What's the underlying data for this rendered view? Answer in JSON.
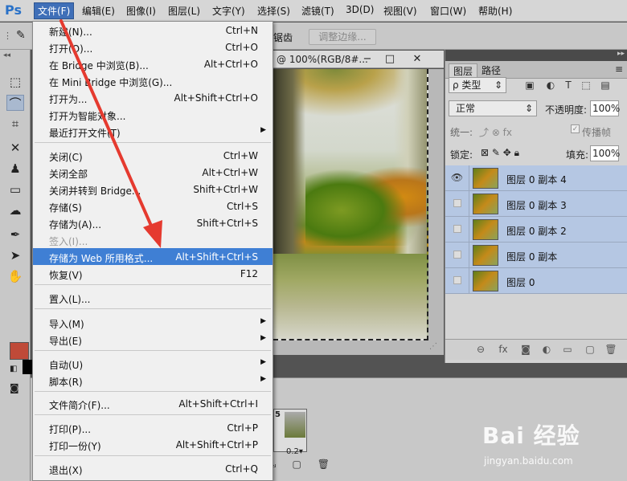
{
  "app": {
    "logo": "Ps"
  },
  "menubar": {
    "items": [
      {
        "label": "文件(F)"
      },
      {
        "label": "编辑(E)"
      },
      {
        "label": "图像(I)"
      },
      {
        "label": "图层(L)"
      },
      {
        "label": "文字(Y)"
      },
      {
        "label": "选择(S)"
      },
      {
        "label": "滤镜(T)"
      },
      {
        "label": "3D(D)"
      },
      {
        "label": "视图(V)"
      },
      {
        "label": "窗口(W)"
      },
      {
        "label": "帮助(H)"
      }
    ]
  },
  "options": {
    "partial_label": "锯齿",
    "refine_edge": "调整边缘..."
  },
  "document": {
    "title": "@ 100%(RGB/8#...",
    "minimize": "−",
    "maximize": "□",
    "close": "✕"
  },
  "file_menu": {
    "items": [
      {
        "label": "新建(N)...",
        "shortcut": "Ctrl+N"
      },
      {
        "label": "打开(O)...",
        "shortcut": "Ctrl+O"
      },
      {
        "label": "在 Bridge 中浏览(B)...",
        "shortcut": "Alt+Ctrl+O"
      },
      {
        "label": "在 Mini Bridge 中浏览(G)...",
        "shortcut": ""
      },
      {
        "label": "打开为...",
        "shortcut": "Alt+Shift+Ctrl+O"
      },
      {
        "label": "打开为智能对象...",
        "shortcut": ""
      },
      {
        "label": "最近打开文件(T)",
        "shortcut": ""
      },
      {
        "label": "关闭(C)",
        "shortcut": "Ctrl+W"
      },
      {
        "label": "关闭全部",
        "shortcut": "Alt+Ctrl+W"
      },
      {
        "label": "关闭并转到 Bridge...",
        "shortcut": "Shift+Ctrl+W"
      },
      {
        "label": "存储(S)",
        "shortcut": "Ctrl+S"
      },
      {
        "label": "存储为(A)...",
        "shortcut": "Shift+Ctrl+S"
      },
      {
        "label": "签入(I)...",
        "shortcut": ""
      },
      {
        "label": "存储为 Web 所用格式...",
        "shortcut": "Alt+Shift+Ctrl+S"
      },
      {
        "label": "恢复(V)",
        "shortcut": "F12"
      },
      {
        "label": "置入(L)...",
        "shortcut": ""
      },
      {
        "label": "导入(M)",
        "shortcut": ""
      },
      {
        "label": "导出(E)",
        "shortcut": ""
      },
      {
        "label": "自动(U)",
        "shortcut": ""
      },
      {
        "label": "脚本(R)",
        "shortcut": ""
      },
      {
        "label": "文件简介(F)...",
        "shortcut": "Alt+Shift+Ctrl+I"
      },
      {
        "label": "打印(P)...",
        "shortcut": "Ctrl+P"
      },
      {
        "label": "打印一份(Y)",
        "shortcut": "Alt+Shift+Ctrl+P"
      },
      {
        "label": "退出(X)",
        "shortcut": "Ctrl+Q"
      }
    ],
    "highlighted_index": 13
  },
  "layers_panel": {
    "tabs": [
      {
        "label": "图层"
      },
      {
        "label": "路径"
      }
    ],
    "kind_filter": "ρ 类型",
    "blend_mode": "正常",
    "opacity_label": "不透明度:",
    "opacity_value": "100%",
    "unify_label": "统一:",
    "propagate_label": "传播帧",
    "lock_label": "锁定:",
    "fill_label": "填充:",
    "fill_value": "100%",
    "layers": [
      {
        "name": "图层 0 副本 4",
        "visible": true
      },
      {
        "name": "图层 0 副本 3",
        "visible": false
      },
      {
        "name": "图层 0 副本 2",
        "visible": false
      },
      {
        "name": "图层 0 副本",
        "visible": false
      },
      {
        "name": "图层 0",
        "visible": false
      }
    ]
  },
  "timeline": {
    "frame_number": "5",
    "frame_delay": "0.2▾"
  },
  "watermark": {
    "brand": "Bai 经验",
    "url": "jingyan.baidu.com"
  },
  "colors": {
    "foreground": "#bf4a38",
    "background": "#000000",
    "menu_highlight": "#3f7fd4",
    "annotation_arrow": "#e53a2f"
  }
}
